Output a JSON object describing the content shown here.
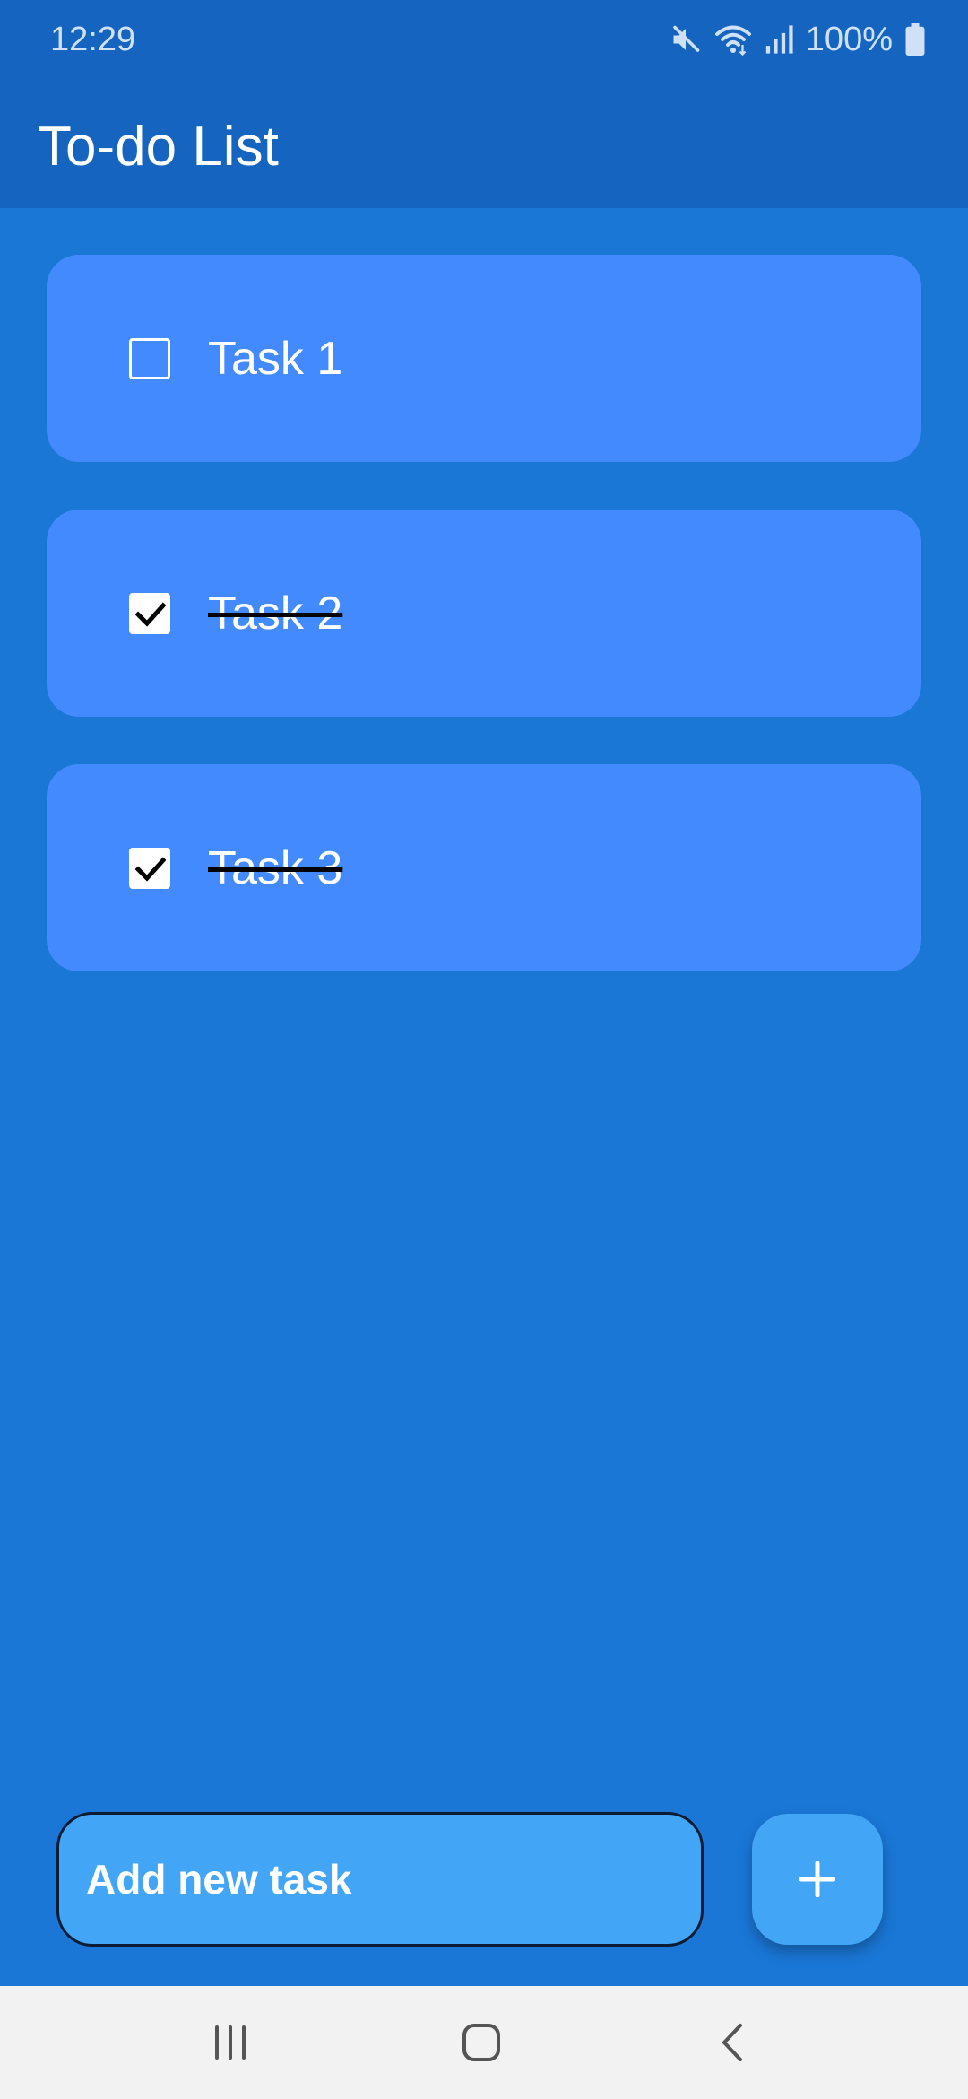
{
  "status_bar": {
    "time": "12:29",
    "battery": "100%",
    "icons": [
      "mute-icon",
      "wifi-icon",
      "signal-icon",
      "battery-icon"
    ]
  },
  "app_bar": {
    "title": "To-do List"
  },
  "tasks": [
    {
      "label": "Task 1",
      "checked": false
    },
    {
      "label": "Task 2",
      "checked": true
    },
    {
      "label": "Task 3",
      "checked": true
    }
  ],
  "new_task": {
    "placeholder": "Add new task",
    "value": "",
    "add_icon": "plus-icon"
  },
  "nav_bar": {
    "icons": [
      "recents-icon",
      "home-icon",
      "back-icon"
    ]
  },
  "colors": {
    "app_bar": "#1565c0",
    "background": "#1a77d6",
    "card": "#448aff",
    "input": "#42a5f5",
    "nav_bar": "#f2f2f2"
  }
}
